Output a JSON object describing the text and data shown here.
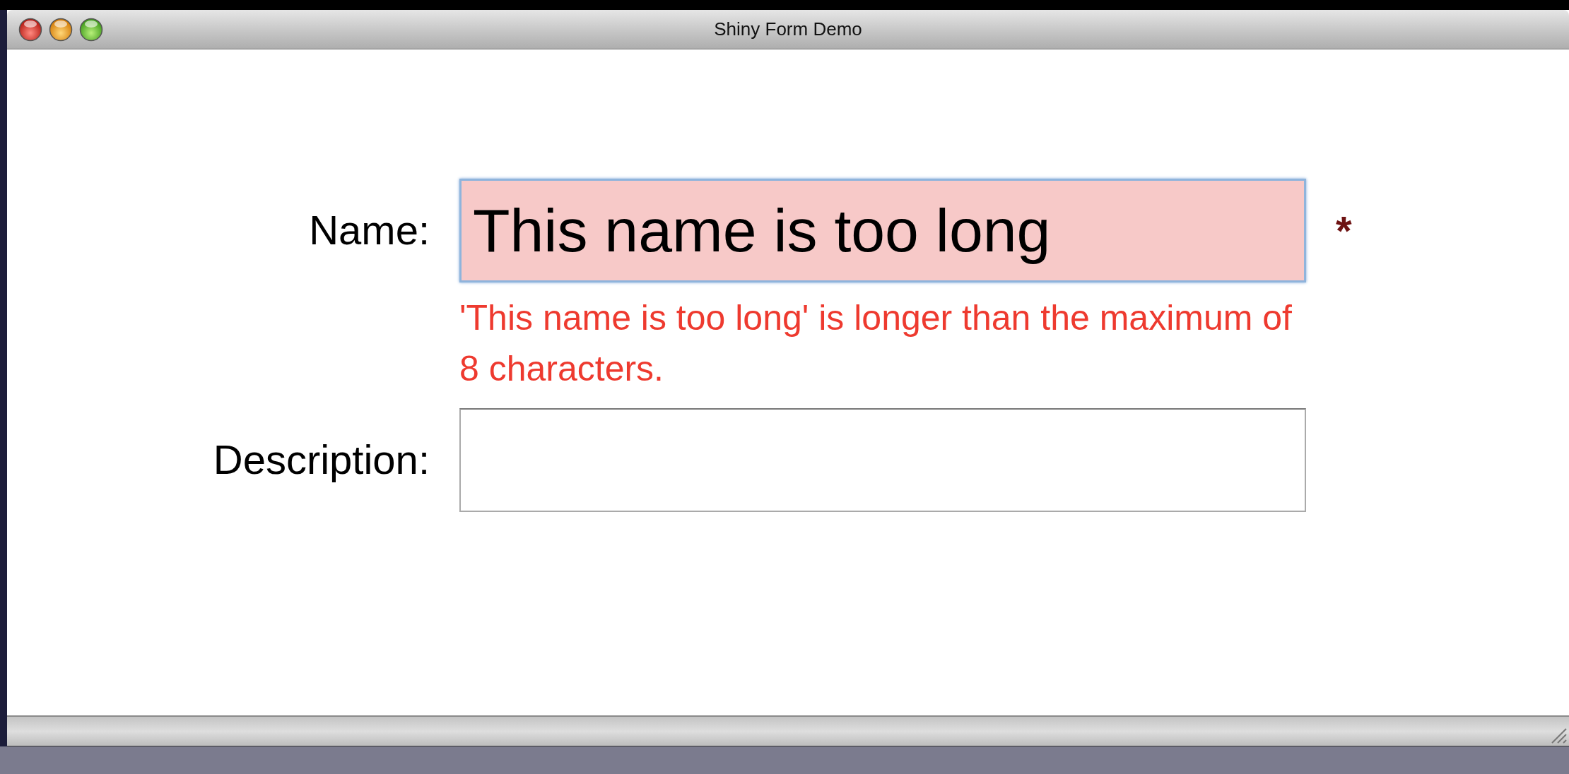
{
  "window": {
    "title": "Shiny Form Demo"
  },
  "fields": [
    {
      "label": "Name:",
      "value": "This name is too long",
      "invalid": true,
      "marker": "*",
      "error": "'This name is too long' is longer than the maximum of 8 characters."
    },
    {
      "label": "Description:",
      "invalid": false
    }
  ]
}
